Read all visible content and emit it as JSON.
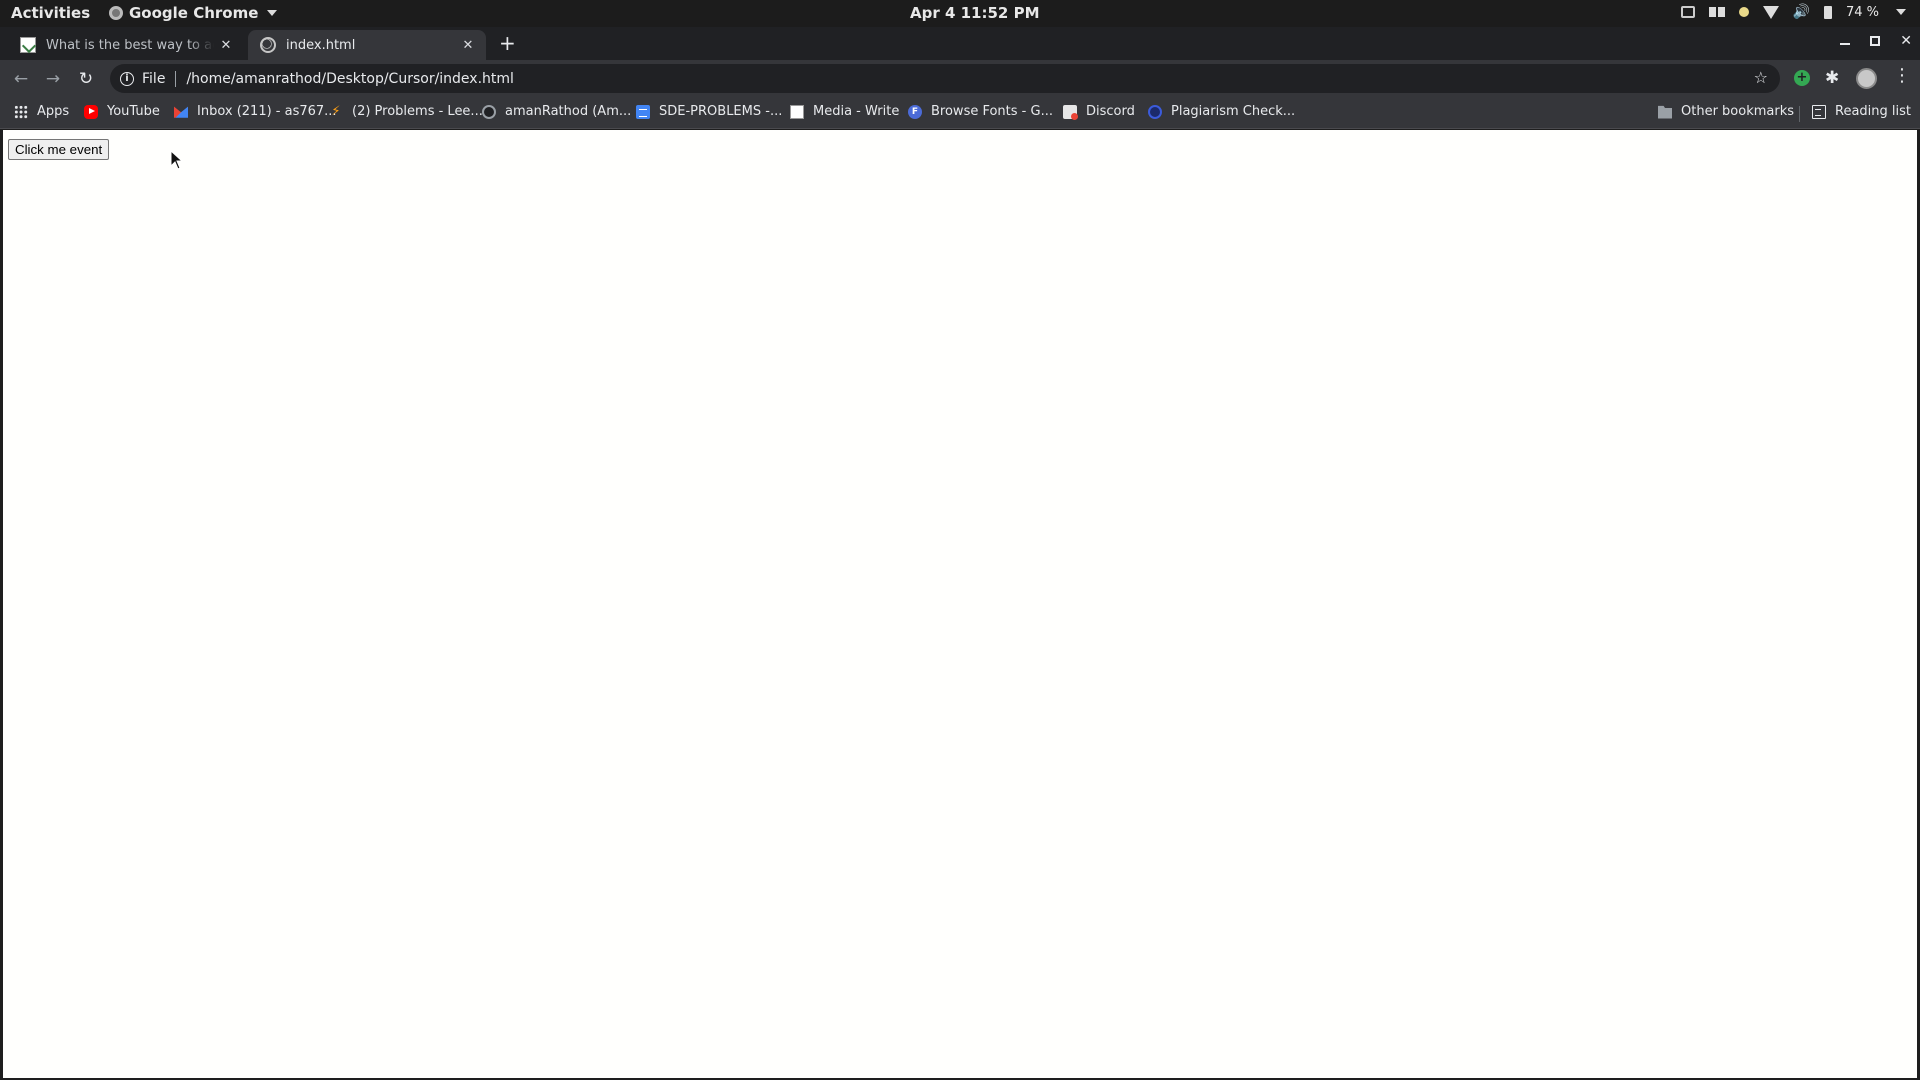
{
  "topbar": {
    "activities": "Activities",
    "app_name": "Google Chrome",
    "clock": "Apr 4  11:52 PM",
    "battery": "74 %"
  },
  "tabs": [
    {
      "title": "What is the best way to add a",
      "active": false,
      "favicon": "doc-favicon"
    },
    {
      "title": "index.html",
      "active": true,
      "favicon": "globe-icon"
    }
  ],
  "omnibox": {
    "scheme": "File",
    "url": "/home/amanrathod/Desktop/Cursor/index.html"
  },
  "bookmarks": [
    {
      "label": "Apps",
      "icon": "apps-grid-icon"
    },
    {
      "label": "YouTube",
      "icon": "youtube-icon"
    },
    {
      "label": "Inbox (211) - as767...",
      "icon": "gmail-icon"
    },
    {
      "label": "(2) Problems - Lee...",
      "icon": "leetcode-icon"
    },
    {
      "label": "amanRathod (Am...",
      "icon": "github-icon"
    },
    {
      "label": "SDE-PROBLEMS -...",
      "icon": "docs-icon"
    },
    {
      "label": "Media - Write",
      "icon": "media-icon"
    },
    {
      "label": "Browse Fonts - G...",
      "icon": "fonts-icon"
    },
    {
      "label": "Discord",
      "icon": "discord-icon"
    },
    {
      "label": "Plagiarism Check...",
      "icon": "plagiarism-icon"
    }
  ],
  "bookmarks_right": {
    "other": "Other bookmarks",
    "reading_list": "Reading list"
  },
  "page": {
    "button_label": "Click me event"
  }
}
